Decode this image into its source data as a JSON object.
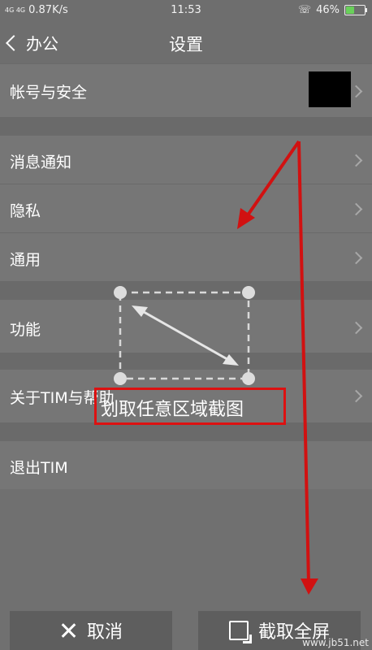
{
  "status_bar": {
    "network": "4G 4G",
    "speed": "0.87K/s",
    "time": "11:53",
    "battery": "46%"
  },
  "header": {
    "back_label": "办公",
    "title": "设置"
  },
  "rows": [
    {
      "label": "帐号与安全"
    },
    {
      "label": "消息通知"
    },
    {
      "label": "隐私"
    },
    {
      "label": "通用"
    },
    {
      "label": "功能"
    },
    {
      "label": "关于TIM与帮助"
    },
    {
      "label": "退出TIM"
    }
  ],
  "overlay": {
    "caption": "划取任意区域截图"
  },
  "bottom": {
    "cancel_label": "取消",
    "capture_label": "截取全屏"
  },
  "watermark": "www.jb51.net",
  "colors": {
    "annotation_red": "#d11111",
    "battery_green": "#69d05a"
  }
}
